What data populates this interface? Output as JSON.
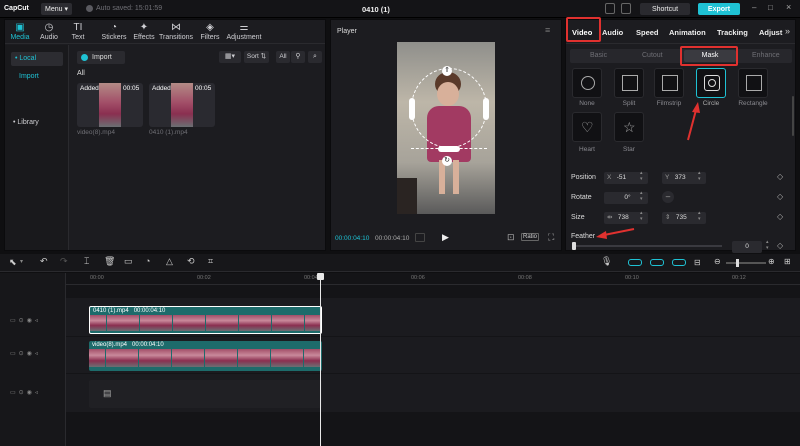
{
  "app": {
    "logo": "CapCut",
    "menu": "Menu",
    "autosave": "Auto saved: 15:01:59",
    "project_title": "0410 (1)",
    "shortcut": "Shortcut",
    "export": "Export"
  },
  "toolbar_tabs": [
    {
      "label": "Media",
      "icon": "media-icon"
    },
    {
      "label": "Audio",
      "icon": "audio-icon"
    },
    {
      "label": "Text",
      "icon": "text-icon"
    },
    {
      "label": "Stickers",
      "icon": "stickers-icon"
    },
    {
      "label": "Effects",
      "icon": "effects-icon"
    },
    {
      "label": "Transitions",
      "icon": "transitions-icon"
    },
    {
      "label": "Filters",
      "icon": "filters-icon"
    },
    {
      "label": "Adjustment",
      "icon": "adjustment-icon"
    }
  ],
  "media": {
    "nav": [
      "• Local",
      "Import",
      "• Library"
    ],
    "import": "Import",
    "sort": "Sort",
    "all_btn": "All",
    "all_label": "All",
    "clips": [
      {
        "badge": "Added",
        "duration": "00:05",
        "name": "video(8).mp4"
      },
      {
        "badge": "Added",
        "duration": "00:05",
        "name": "0410 (1).mp4"
      }
    ]
  },
  "player": {
    "title": "Player",
    "current": "00:00:04:10",
    "total": "00:00:04:10",
    "ratio": "Ratio"
  },
  "inspector": {
    "tabs": [
      "Video",
      "Audio",
      "Speed",
      "Animation",
      "Tracking",
      "Adjust"
    ],
    "subtabs": [
      "Basic",
      "Cutout",
      "Mask",
      "Enhance"
    ],
    "masks": [
      "None",
      "Split",
      "Filmstrip",
      "Circle",
      "Rectangle",
      "Heart",
      "Star"
    ],
    "position_label": "Position",
    "x_label": "X",
    "x_value": "-51",
    "y_label": "Y",
    "y_value": "373",
    "rotate_label": "Rotate",
    "rotate_value": "0°",
    "size_label": "Size",
    "w_value": "738",
    "h_value": "735",
    "feather_label": "Feather",
    "feather_value": "0",
    "feather_level": 0
  },
  "timeline": {
    "ticks": [
      "00:00",
      "00:02",
      "00:04",
      "00:06",
      "00:08",
      "00:10",
      "00:12"
    ],
    "clip1": "0410 (1).mp4   00:00:04:10",
    "clip2": "video(8).mp4   00:00:04:10"
  },
  "colors": {
    "accent": "#1fc2d4",
    "highlight": "#e0312f",
    "clip": "#1d6b6b"
  }
}
